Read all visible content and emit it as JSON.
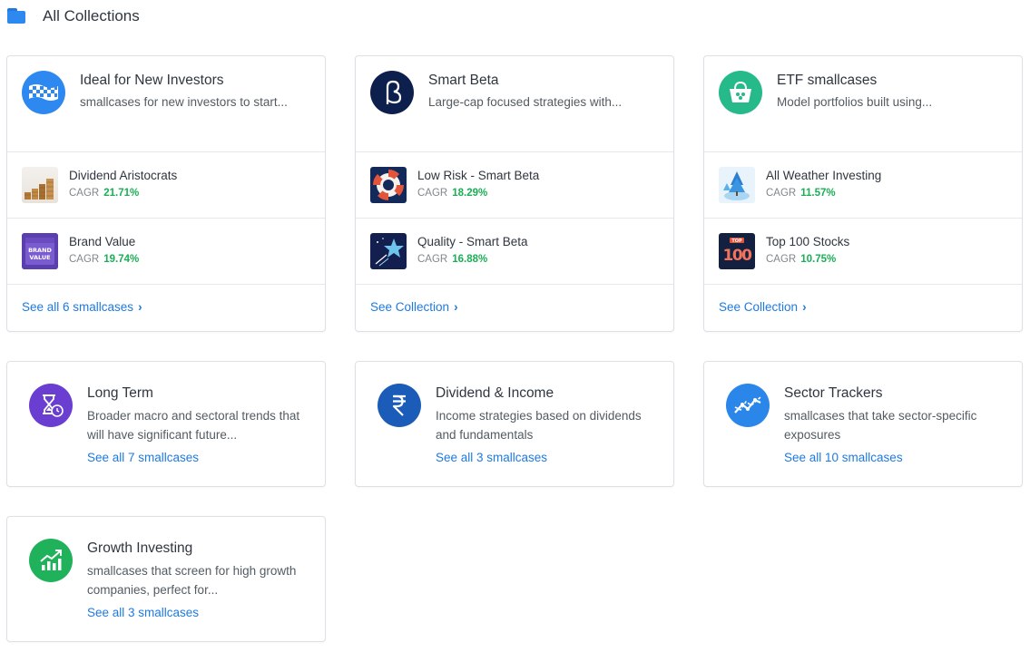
{
  "header": {
    "title": "All Collections",
    "icon": "folder-icon"
  },
  "featured": [
    {
      "title": "Ideal for New Investors",
      "desc": "smallcases for new investors to start...",
      "icon": "checkered-flag-icon",
      "color": "#2d89ef",
      "items": [
        {
          "name": "Dividend Aristocrats",
          "cagr_label": "CAGR",
          "cagr": "21.71%",
          "thumb": "coin-stacks-thumb"
        },
        {
          "name": "Brand Value",
          "cagr_label": "CAGR",
          "cagr": "19.74%",
          "thumb": "brand-value-thumb",
          "thumb_text1": "BRAND",
          "thumb_text2": "VALUE"
        }
      ],
      "link": "See all 6 smallcases"
    },
    {
      "title": "Smart Beta",
      "desc": "Large-cap focused strategies with...",
      "icon": "beta-icon",
      "color": "#0d1f4d",
      "items": [
        {
          "name": "Low Risk - Smart Beta",
          "cagr_label": "CAGR",
          "cagr": "18.29%",
          "thumb": "lifebuoy-thumb"
        },
        {
          "name": "Quality - Smart Beta",
          "cagr_label": "CAGR",
          "cagr": "16.88%",
          "thumb": "star-thumb"
        }
      ],
      "link": "See Collection"
    },
    {
      "title": "ETF smallcases",
      "desc": "Model portfolios built using...",
      "icon": "basket-icon",
      "color": "#26b98a",
      "items": [
        {
          "name": "All Weather Investing",
          "cagr_label": "CAGR",
          "cagr": "11.57%",
          "thumb": "weather-thumb"
        },
        {
          "name": "Top 100 Stocks",
          "cagr_label": "CAGR",
          "cagr": "10.75%",
          "thumb": "top100-thumb",
          "thumb_text1": "TOP",
          "thumb_text2": "100"
        }
      ],
      "link": "See Collection"
    }
  ],
  "collections": [
    {
      "title": "Long Term",
      "desc": "Broader macro and sectoral trends that will have significant future...",
      "link": "See all 7 smallcases",
      "icon": "hourglass-clock-icon",
      "color": "#6a3ed1"
    },
    {
      "title": "Dividend & Income",
      "desc": "Income strategies based on dividends and fundamentals",
      "link": "See all 3 smallcases",
      "icon": "rupee-icon",
      "color": "#1b5cb8"
    },
    {
      "title": "Sector Trackers",
      "desc": "smallcases that take sector-specific exposures",
      "link": "See all 10 smallcases",
      "icon": "trend-line-icon",
      "color": "#2a86e8"
    },
    {
      "title": "Growth Investing",
      "desc": "smallcases that screen for high growth companies, perfect for...",
      "link": "See all 3 smallcases",
      "icon": "growth-chart-icon",
      "color": "#1fb25a"
    }
  ],
  "chevron": "›"
}
